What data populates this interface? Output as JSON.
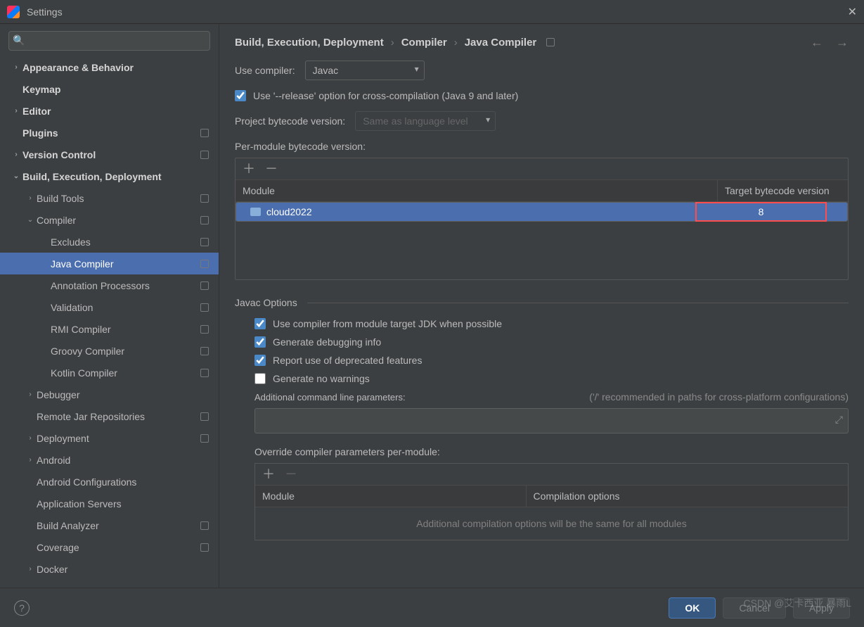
{
  "window": {
    "title": "Settings"
  },
  "search": {
    "placeholder": ""
  },
  "sidebar": [
    {
      "label": "Appearance & Behavior",
      "depth": 0,
      "chev": "›",
      "bold": true
    },
    {
      "label": "Keymap",
      "depth": 0,
      "chev": "",
      "bold": true
    },
    {
      "label": "Editor",
      "depth": 0,
      "chev": "›",
      "bold": true
    },
    {
      "label": "Plugins",
      "depth": 0,
      "chev": "",
      "bold": true,
      "badge": true
    },
    {
      "label": "Version Control",
      "depth": 0,
      "chev": "›",
      "bold": true,
      "badge": true
    },
    {
      "label": "Build, Execution, Deployment",
      "depth": 0,
      "chev": "⌄",
      "bold": true
    },
    {
      "label": "Build Tools",
      "depth": 1,
      "chev": "›",
      "badge": true
    },
    {
      "label": "Compiler",
      "depth": 1,
      "chev": "⌄",
      "badge": true
    },
    {
      "label": "Excludes",
      "depth": 2,
      "chev": "",
      "badge": true
    },
    {
      "label": "Java Compiler",
      "depth": 2,
      "chev": "",
      "badge": true,
      "selected": true
    },
    {
      "label": "Annotation Processors",
      "depth": 2,
      "chev": "",
      "badge": true
    },
    {
      "label": "Validation",
      "depth": 2,
      "chev": "",
      "badge": true
    },
    {
      "label": "RMI Compiler",
      "depth": 2,
      "chev": "",
      "badge": true
    },
    {
      "label": "Groovy Compiler",
      "depth": 2,
      "chev": "",
      "badge": true
    },
    {
      "label": "Kotlin Compiler",
      "depth": 2,
      "chev": "",
      "badge": true
    },
    {
      "label": "Debugger",
      "depth": 1,
      "chev": "›"
    },
    {
      "label": "Remote Jar Repositories",
      "depth": 1,
      "chev": "",
      "badge": true
    },
    {
      "label": "Deployment",
      "depth": 1,
      "chev": "›",
      "badge": true
    },
    {
      "label": "Android",
      "depth": 1,
      "chev": "›"
    },
    {
      "label": "Android Configurations",
      "depth": 1,
      "chev": ""
    },
    {
      "label": "Application Servers",
      "depth": 1,
      "chev": ""
    },
    {
      "label": "Build Analyzer",
      "depth": 1,
      "chev": "",
      "badge": true
    },
    {
      "label": "Coverage",
      "depth": 1,
      "chev": "",
      "badge": true
    },
    {
      "label": "Docker",
      "depth": 1,
      "chev": "›"
    }
  ],
  "breadcrumb": {
    "items": [
      "Build, Execution, Deployment",
      "Compiler",
      "Java Compiler"
    ]
  },
  "form": {
    "use_compiler_lbl": "Use compiler:",
    "use_compiler_val": "Javac",
    "release_chk": "Use '--release' option for cross-compilation (Java 9 and later)",
    "bytecode_lbl": "Project bytecode version:",
    "bytecode_val": "Same as language level",
    "per_module_lbl": "Per-module bytecode version:",
    "module_head": "Module",
    "target_head": "Target bytecode version",
    "module_rows": [
      {
        "name": "cloud2022",
        "target": "8"
      }
    ],
    "javac_legend": "Javac Options",
    "opt_jdk": "Use compiler from module target JDK when possible",
    "opt_debug": "Generate debugging info",
    "opt_deprecated": "Report use of deprecated features",
    "opt_nowarn": "Generate no warnings",
    "addl_params_lbl": "Additional command line parameters:",
    "addl_params_hint": "('/' recommended in paths for cross-platform configurations)",
    "override_lbl": "Override compiler parameters per-module:",
    "override_head_module": "Module",
    "override_head_opts": "Compilation options",
    "override_empty": "Additional compilation options will be the same for all modules"
  },
  "footer": {
    "ok": "OK",
    "cancel": "Cancel",
    "apply": "Apply"
  },
  "watermark": "CSDN @艾卡西亚 暴雨L"
}
